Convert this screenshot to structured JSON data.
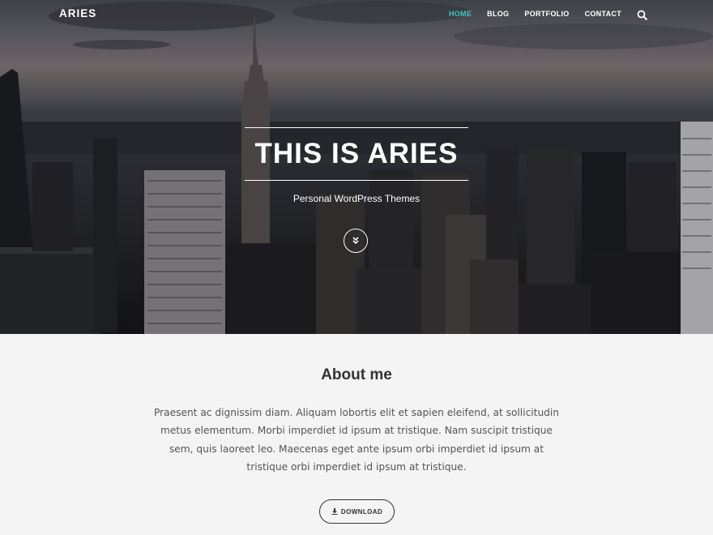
{
  "nav": {
    "logo": "ARIES",
    "items": [
      {
        "label": "HOME",
        "active": true
      },
      {
        "label": "BLOG",
        "active": false
      },
      {
        "label": "PORTFOLIO",
        "active": false
      },
      {
        "label": "CONTACT",
        "active": false
      }
    ],
    "search_icon": "search-icon"
  },
  "hero": {
    "title": "THIS IS ARIES",
    "subtitle": "Personal WordPress Themes",
    "scroll_icon": "chevron-double-down-icon"
  },
  "about": {
    "title": "About me",
    "text": "Praesent ac dignissim diam. Aliquam lobortis elit et sapien eleifend, at sollicitudin metus elementum. Morbi imperdiet id ipsum at tristique. Nam suscipit tristique sem, quis laoreet leo. Maecenas eget ante ipsum orbi imperdiet id ipsum at tristique orbi imperdiet id ipsum at tristique.",
    "download_label": "DOWNLOAD",
    "download_icon": "download-icon"
  },
  "colors": {
    "accent": "#3ec9c2",
    "text_dark": "#333333",
    "body_text": "#555555",
    "section_bg": "#f4f4f4"
  }
}
